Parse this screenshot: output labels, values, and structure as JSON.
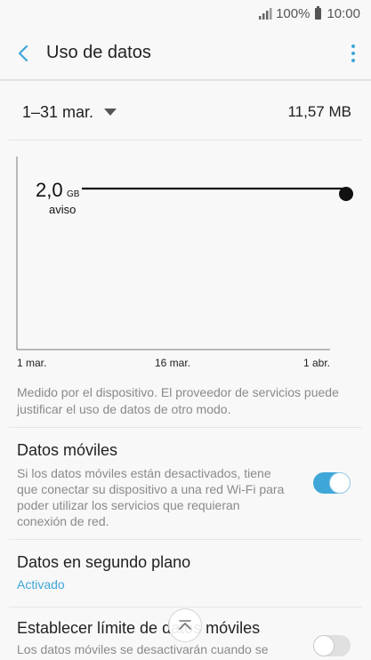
{
  "status_bar": {
    "battery_percent": "100%",
    "time": "10:00",
    "icons": [
      "signal-icon",
      "battery-icon"
    ]
  },
  "app_bar": {
    "title": "Uso de datos",
    "icons": [
      "back-arrow-icon",
      "more-options-icon"
    ]
  },
  "cycle": {
    "range_label": "1–31 mar.",
    "total_usage": "11,57 MB"
  },
  "chart_data": {
    "type": "line",
    "warning_value": "2,0",
    "warning_unit": "GB",
    "warning_label": "aviso",
    "x_ticks": [
      "1 mar.",
      "16 mar.",
      "1 abr."
    ],
    "usage_series_visible": false
  },
  "note": "Medido por el dispositivo. El proveedor de servicios puede justificar el uso de datos de otro modo.",
  "settings": [
    {
      "title": "Datos móviles",
      "description": "Si los datos móviles están desactivados, tiene que conectar su dispositivo a una red Wi-Fi para poder utilizar los servicios que requieran conexión de red.",
      "toggle": true
    },
    {
      "title": "Datos en segundo plano",
      "status": "Activado"
    },
    {
      "title": "Establecer límite de datos móviles",
      "description": "Los datos móviles se desactivarán cuando se",
      "toggle": false
    }
  ],
  "colors": {
    "accent": "#3fa6d8",
    "background": "#f8f8f8",
    "secondary_text": "#8a8a8a"
  }
}
